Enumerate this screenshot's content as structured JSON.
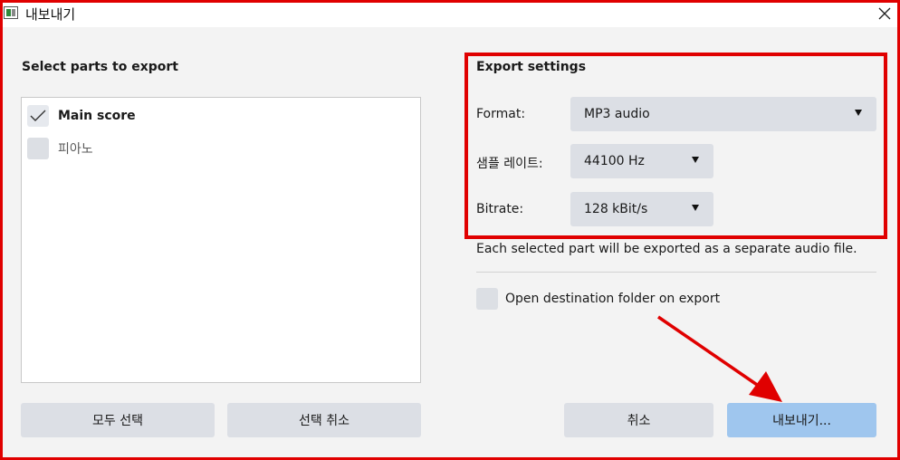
{
  "window": {
    "title": "내보내기",
    "icon": "app-window-icon",
    "close_icon": "close-icon"
  },
  "left_panel": {
    "title": "Select parts to export",
    "parts": [
      {
        "label": "Main score",
        "checked": true
      },
      {
        "label": "피아노",
        "checked": false
      }
    ],
    "select_all_label": "모두 선택",
    "deselect_all_label": "선택 취소"
  },
  "export_settings": {
    "title": "Export settings",
    "format_label": "Format:",
    "format_value": "MP3 audio",
    "sample_rate_label": "샘플 레이트:",
    "sample_rate_value": "44100 Hz",
    "bitrate_label": "Bitrate:",
    "bitrate_value": "128 kBit/s",
    "info": "Each selected part will be exported as a separate audio file.",
    "open_folder_label": "Open destination folder on export",
    "open_folder_checked": false
  },
  "footer": {
    "cancel_label": "취소",
    "export_label": "내보내기..."
  },
  "colors": {
    "annotation": "#e00000",
    "primary_button": "#9fc6ee",
    "control_bg": "#dcdfe5"
  }
}
